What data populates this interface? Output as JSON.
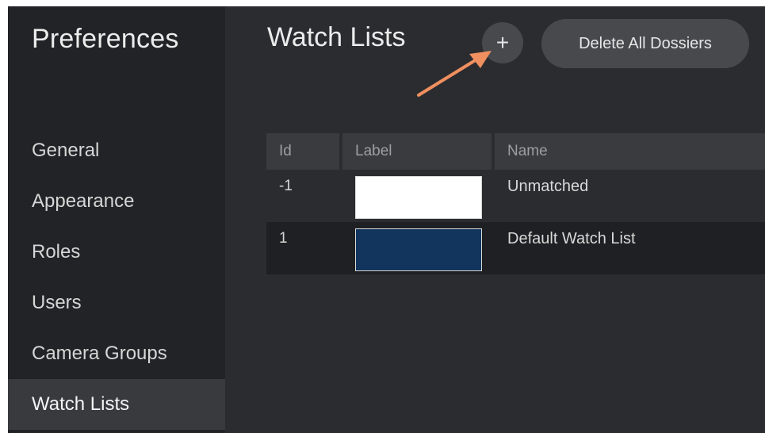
{
  "sidebar": {
    "title": "Preferences",
    "items": [
      {
        "label": "General",
        "active": false
      },
      {
        "label": "Appearance",
        "active": false
      },
      {
        "label": "Roles",
        "active": false
      },
      {
        "label": "Users",
        "active": false
      },
      {
        "label": "Camera Groups",
        "active": false
      },
      {
        "label": "Watch Lists",
        "active": true
      }
    ]
  },
  "main": {
    "title": "Watch Lists",
    "add_button_label": "+",
    "delete_button_label": "Delete All Dossiers",
    "annotation": {
      "type": "arrow",
      "color": "#f08f5f",
      "target": "add-button"
    },
    "table": {
      "columns": [
        "Id",
        "Label",
        "Name"
      ],
      "rows": [
        {
          "id": "-1",
          "label_color": "#ffffff",
          "name": "Unmatched"
        },
        {
          "id": "1",
          "label_color": "#12355e",
          "name": "Default Watch List"
        }
      ]
    }
  }
}
